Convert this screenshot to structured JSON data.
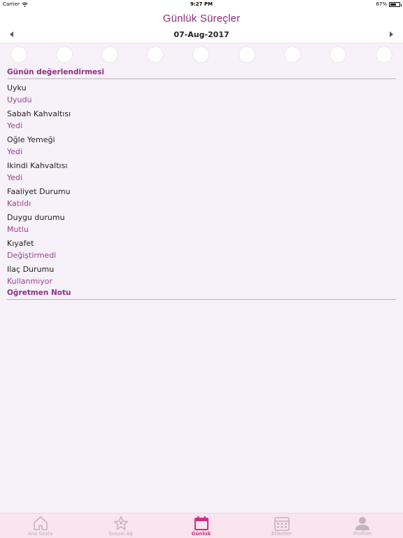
{
  "status_bar": {
    "carrier": "Carrier",
    "time": "9:27 PM",
    "battery": "67%",
    "battery_level": 0.67
  },
  "header": {
    "title": "Günlük Süreçler"
  },
  "date_nav": {
    "date": "07-Aug-2017",
    "prev_icon": "chevron-left-icon",
    "next_icon": "chevron-right-icon"
  },
  "evaluation": {
    "title": "Günün değerlendirmesi",
    "items": [
      {
        "label": "Uyku",
        "value": "Uyudu"
      },
      {
        "label": "Sabah Kahvaltısı",
        "value": "Yedi"
      },
      {
        "label": "Oğle Yemeği",
        "value": "Yedi"
      },
      {
        "label": "Ikindi Kahvaltısı",
        "value": "Yedi"
      },
      {
        "label": "Faaliyet Durumu",
        "value": "Katıldı"
      },
      {
        "label": "Duygu durumu",
        "value": "Mutlu"
      },
      {
        "label": "Kıyafet",
        "value": "Değiştirmedi"
      },
      {
        "label": "Ilaç Durumu",
        "value": "Kullanmıyor"
      }
    ]
  },
  "teacher_note": {
    "title": "Oğretmen Notu"
  },
  "tabs": [
    {
      "label": "Ana Sayfa",
      "icon": "home-icon",
      "active": false
    },
    {
      "label": "Sosyal Ağ",
      "icon": "star-icon",
      "active": false
    },
    {
      "label": "Günlük",
      "icon": "calendar-icon",
      "active": true
    },
    {
      "label": "Etiketler",
      "icon": "calendar-grid-icon",
      "active": false
    },
    {
      "label": "Profilim",
      "icon": "profile-icon",
      "active": false
    }
  ],
  "colors": {
    "accent": "#8e2f82",
    "value_text": "#9a3f8c",
    "tab_active": "#cf2e84",
    "tab_inactive": "#b8a9b4",
    "background": "#f7f2fa"
  }
}
